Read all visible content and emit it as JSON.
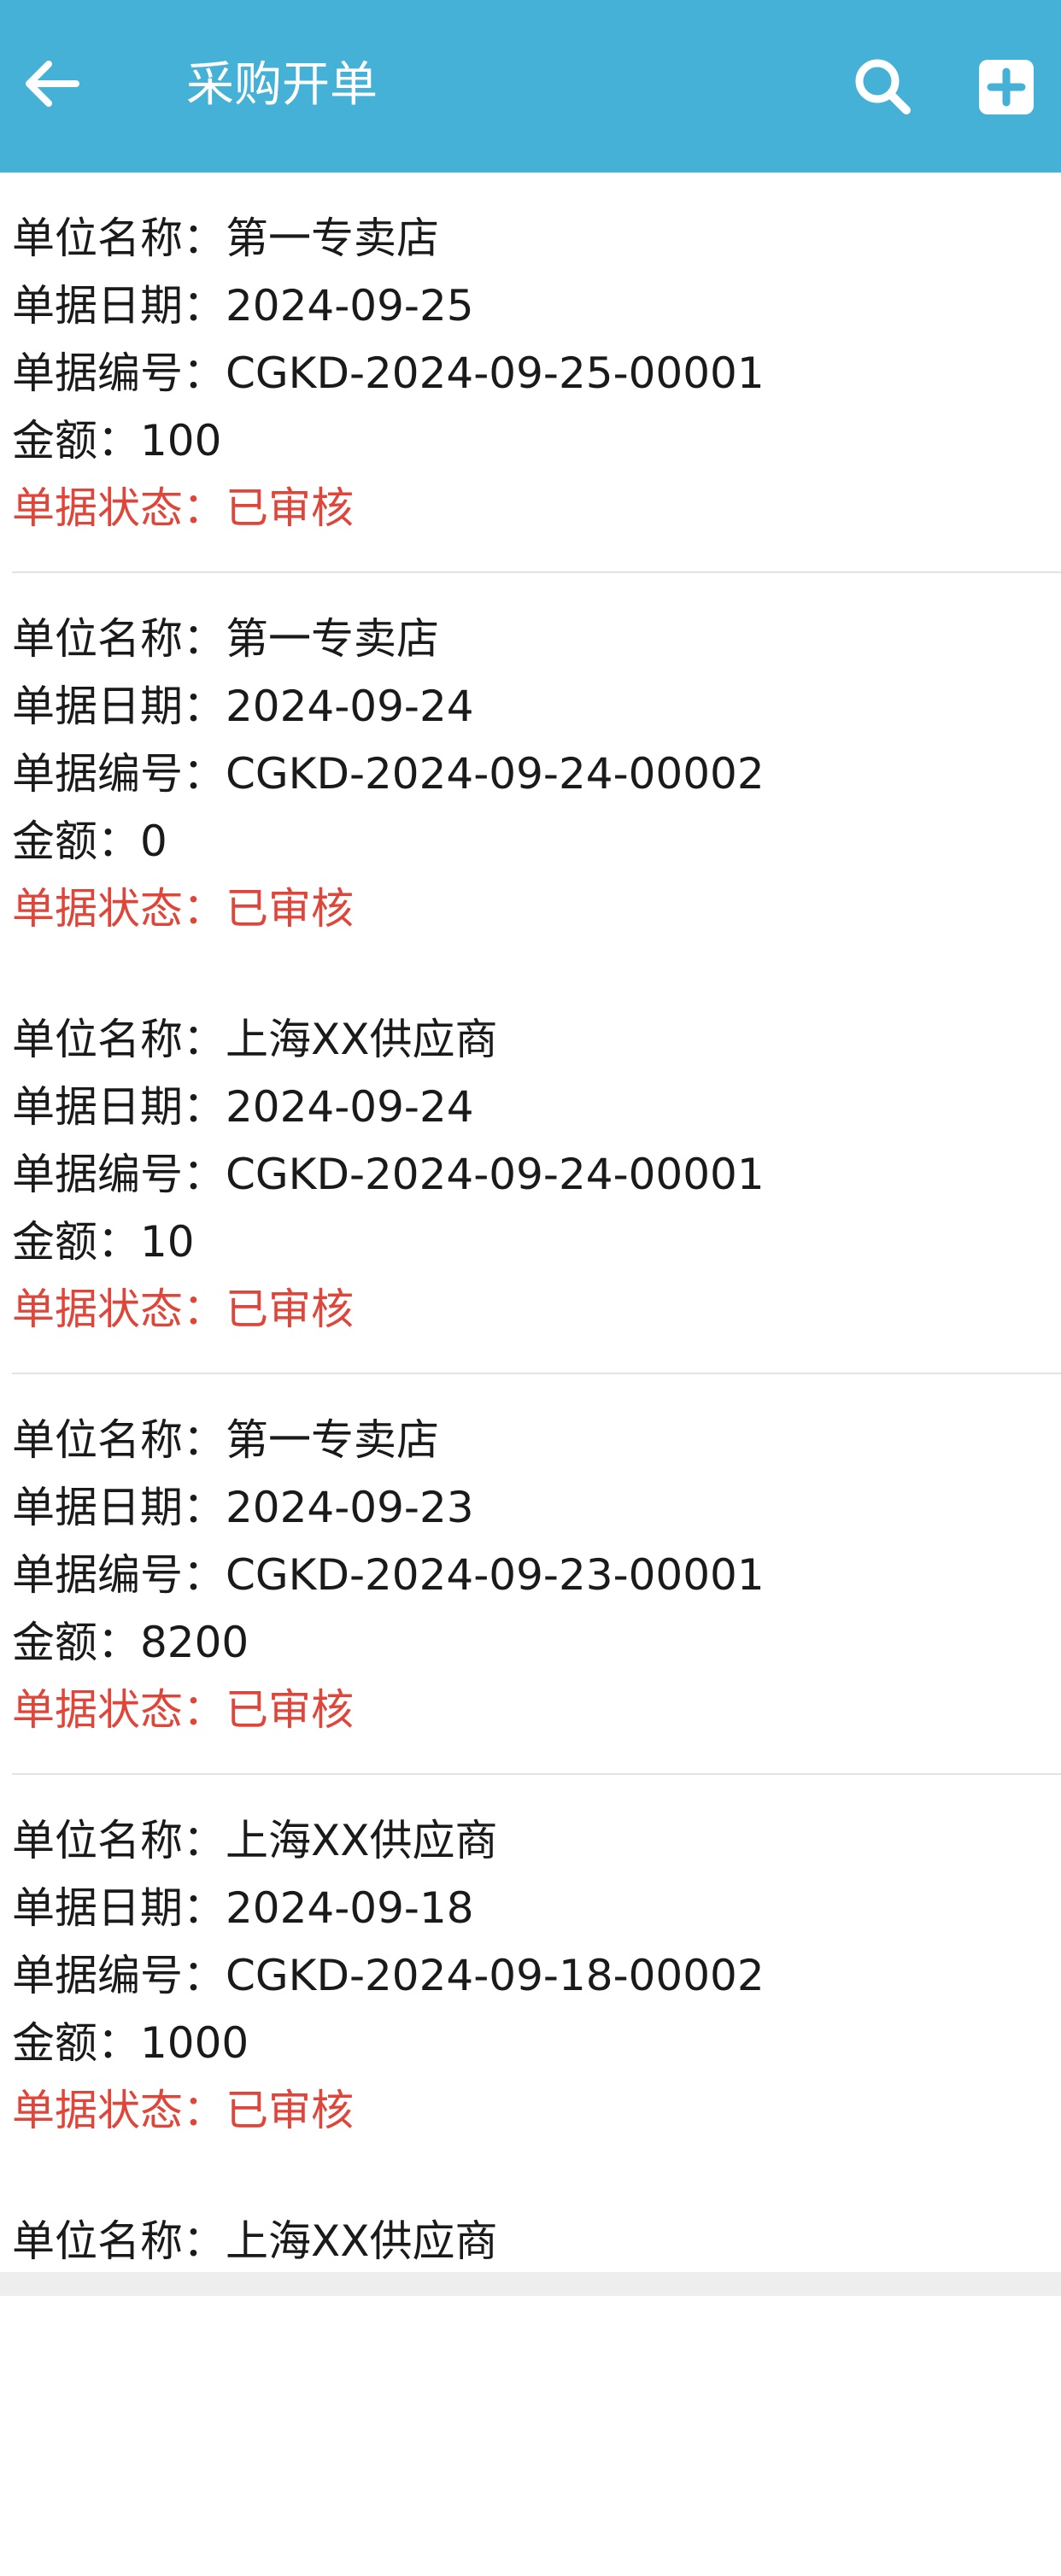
{
  "header": {
    "title": "采购开单",
    "back_icon": "arrow-left-icon",
    "search_icon": "search-icon",
    "add_icon": "plus-square-icon",
    "background_color": "#45b1d6"
  },
  "labels": {
    "unit_name": "单位名称：",
    "doc_date": "单据日期：",
    "doc_no": "单据编号：",
    "amount": "金额：",
    "status": "单据状态："
  },
  "status_color": "#e0453a",
  "records": [
    {
      "unit": "第一专卖店",
      "date": "2024-09-25",
      "no": "CGKD-2024-09-25-00001",
      "amount": "100",
      "status": "已审核"
    },
    {
      "unit": "第一专卖店",
      "date": "2024-09-24",
      "no": "CGKD-2024-09-24-00002",
      "amount": "0",
      "status": "已审核"
    },
    {
      "unit": "上海XX供应商",
      "date": "2024-09-24",
      "no": "CGKD-2024-09-24-00001",
      "amount": "10",
      "status": "已审核"
    },
    {
      "unit": "第一专卖店",
      "date": "2024-09-23",
      "no": "CGKD-2024-09-23-00001",
      "amount": "8200",
      "status": "已审核"
    },
    {
      "unit": "上海XX供应商",
      "date": "2024-09-18",
      "no": "CGKD-2024-09-18-00002",
      "amount": "1000",
      "status": "已审核"
    },
    {
      "unit": "上海XX供应商"
    }
  ]
}
